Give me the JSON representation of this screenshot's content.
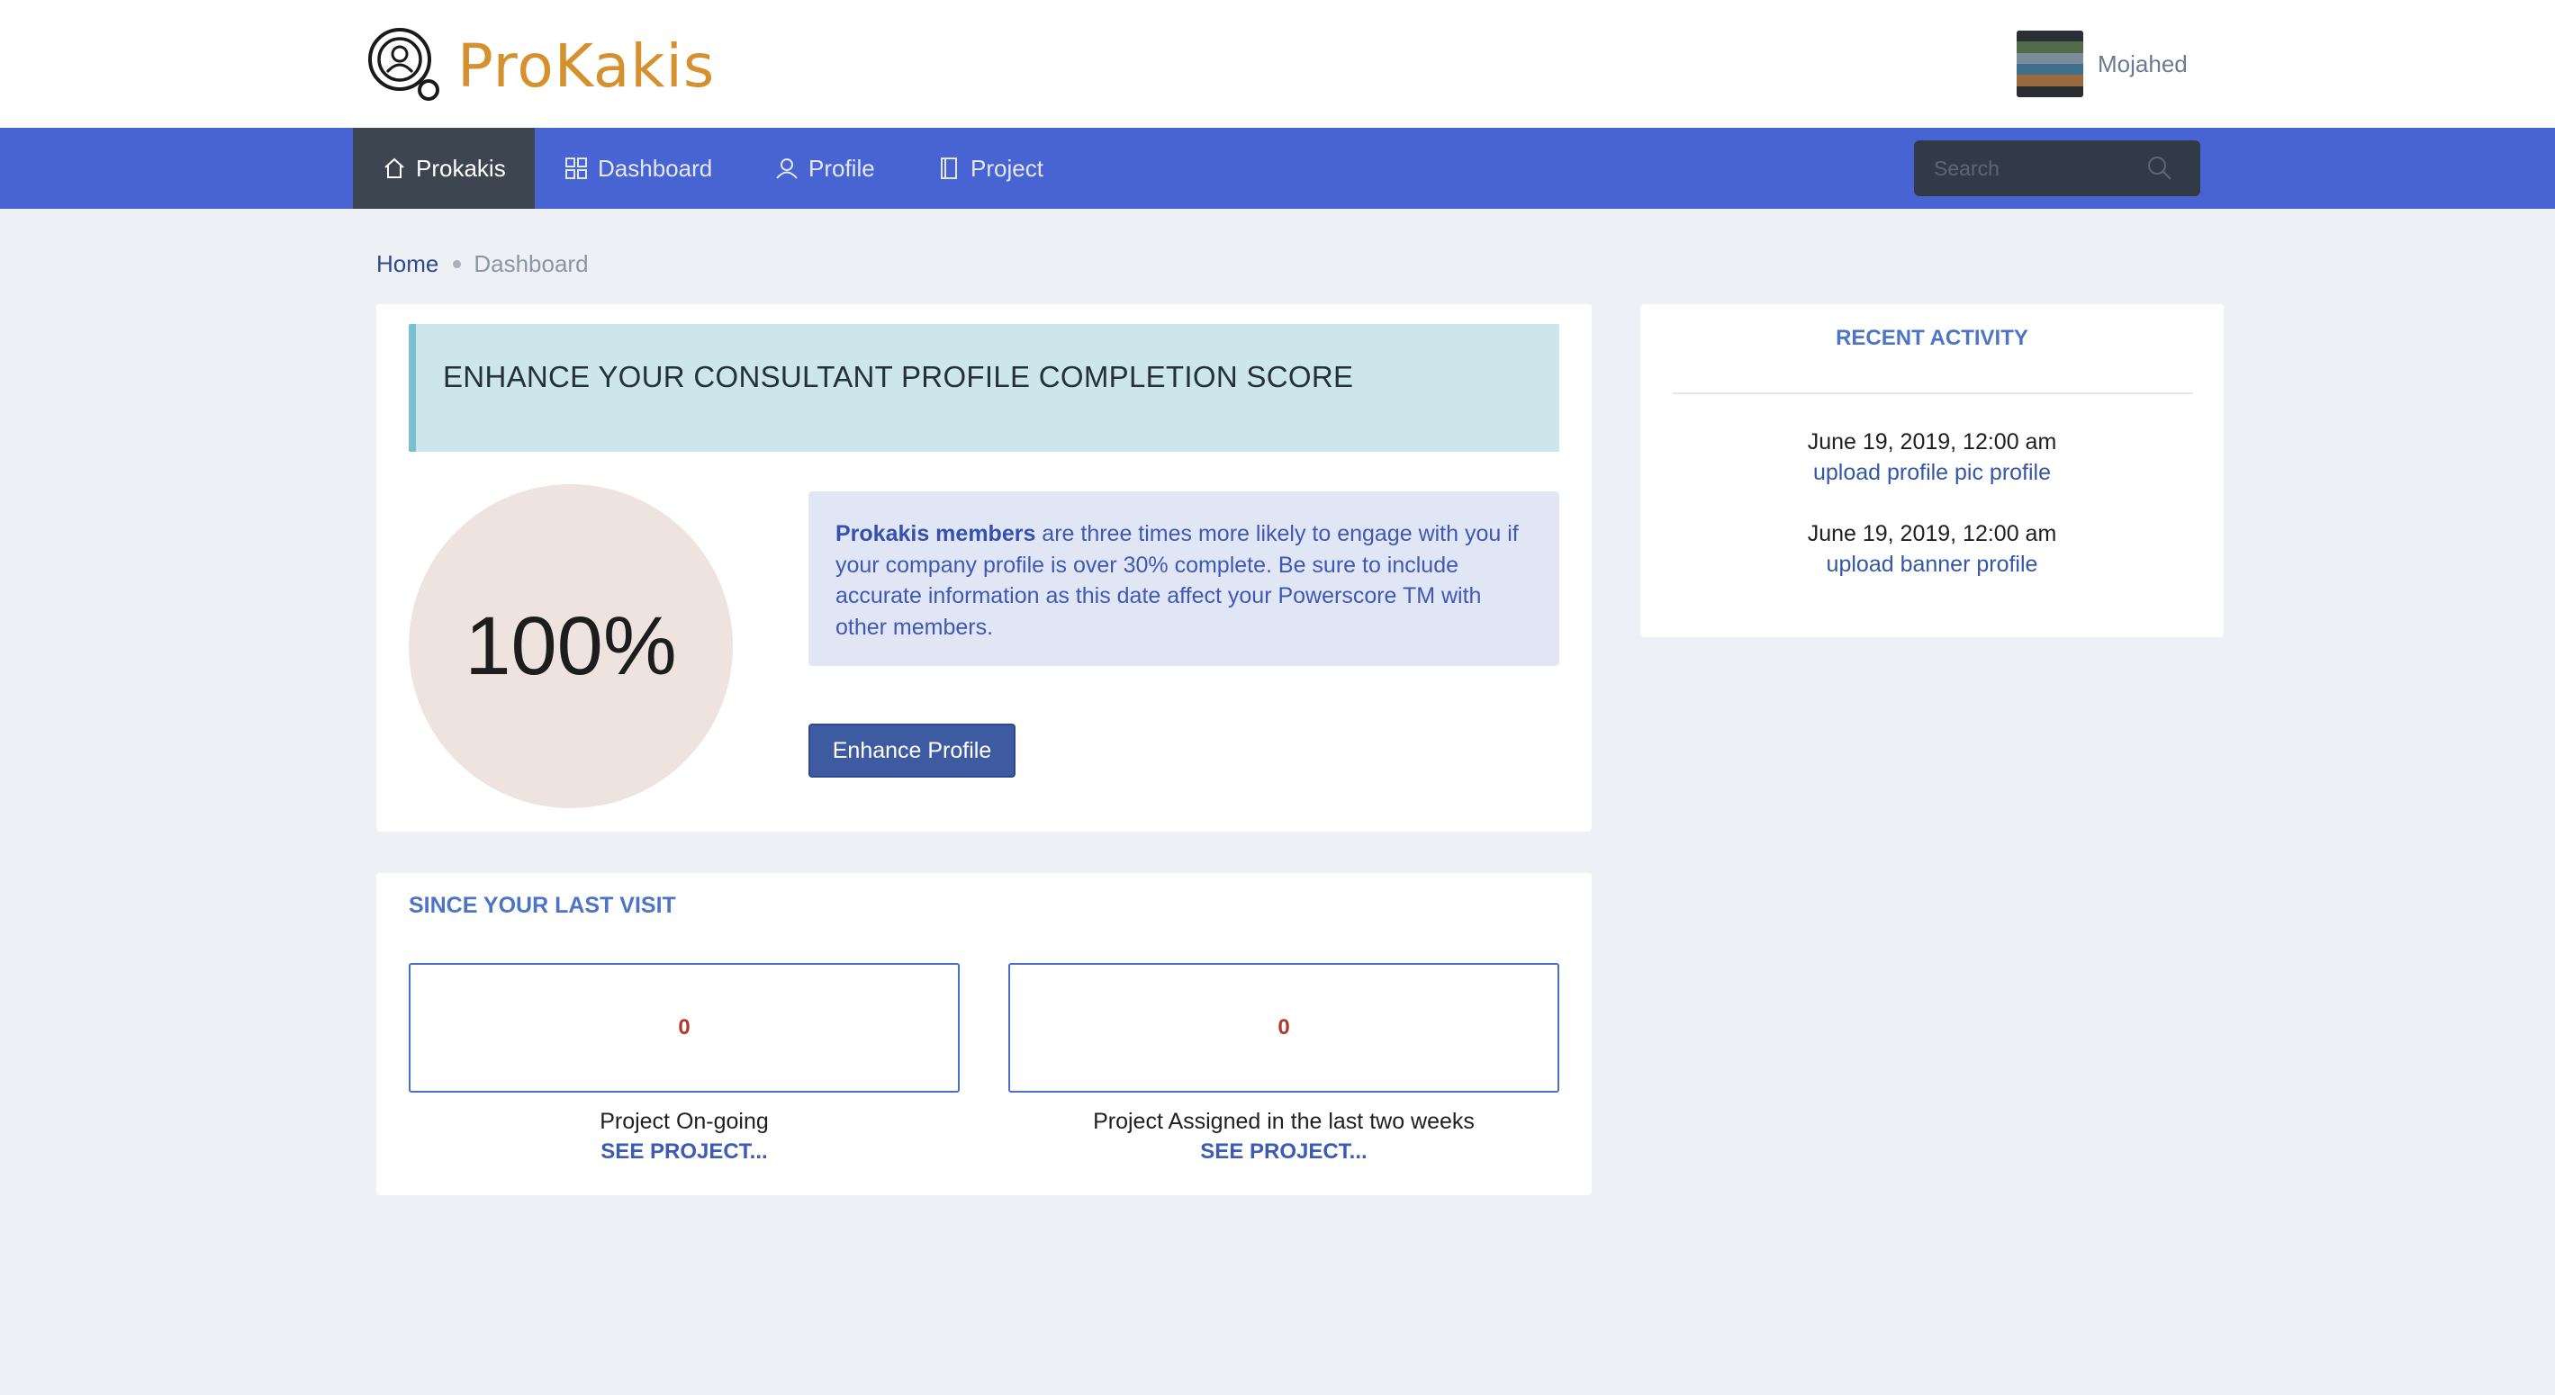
{
  "brand": {
    "name": "ProKakis",
    "color": "#d4912e"
  },
  "user": {
    "name": "Mojahed"
  },
  "nav": {
    "items": [
      {
        "label": "Prokakis",
        "icon": "home-icon",
        "active": true
      },
      {
        "label": "Dashboard",
        "icon": "grid-icon",
        "active": false
      },
      {
        "label": "Profile",
        "icon": "user-icon",
        "active": false
      },
      {
        "label": "Project",
        "icon": "document-icon",
        "active": false
      }
    ],
    "search_placeholder": "Search"
  },
  "breadcrumb": {
    "home": "Home",
    "current": "Dashboard"
  },
  "profile_card": {
    "banner_text": "ENHANCE YOUR CONSULTANT PROFILE COMPLETION SCORE",
    "score": "100%",
    "info_bold": "Prokakis members",
    "info_text": " are three times more likely to engage with you if your company profile is over 30% complete. Be sure to include accurate information as this date affect your Powerscore TM with other members.",
    "button_label": "Enhance Profile"
  },
  "last_visit": {
    "title": "SINCE YOUR LAST VISIT",
    "stats": [
      {
        "value": "0",
        "caption": "Project On-going",
        "link": "SEE PROJECT..."
      },
      {
        "value": "0",
        "caption": "Project Assigned in the last two weeks",
        "link": "SEE PROJECT..."
      }
    ]
  },
  "recent_activity": {
    "title": "RECENT ACTIVITY",
    "items": [
      {
        "date": "June 19, 2019, 12:00 am",
        "desc": "upload profile pic profile"
      },
      {
        "date": "June 19, 2019, 12:00 am",
        "desc": "upload banner profile"
      }
    ]
  },
  "colors": {
    "nav_bg": "#4764d2",
    "nav_active_bg": "#3d4551",
    "page_bg": "#eef0f6",
    "accent_blue": "#4d74c5",
    "stat_value": "#b0392d"
  }
}
